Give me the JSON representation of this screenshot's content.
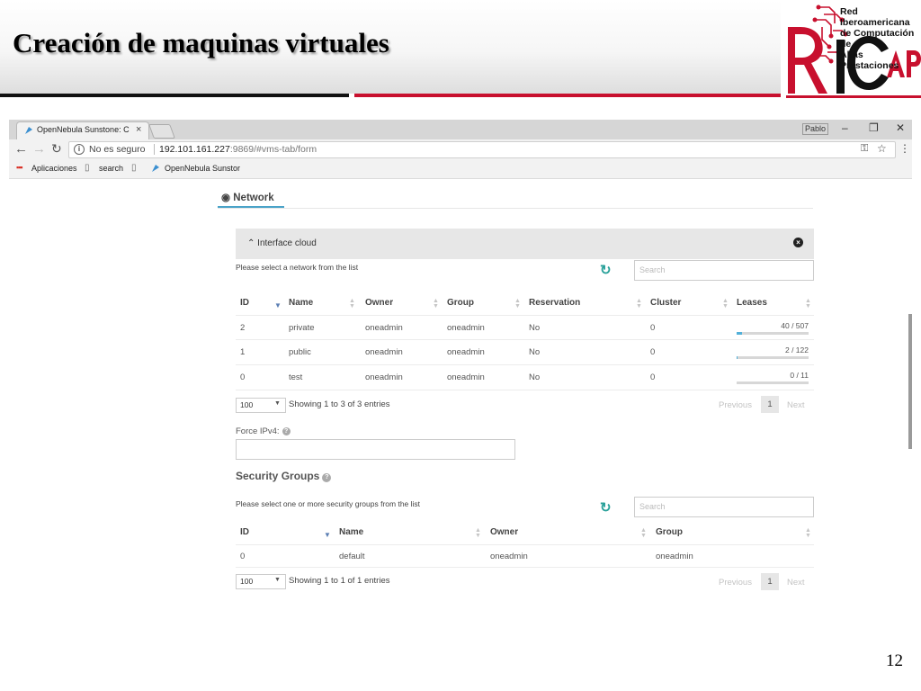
{
  "slide": {
    "title": "Creación de maquinas virtuales",
    "page_number": "12",
    "logo": {
      "text_lines": [
        "Red Iberoamericana",
        "de Computación de",
        "Altas Prestaciones"
      ],
      "mark": "RICAP"
    },
    "colors": {
      "red": "#c8102e",
      "black": "#111111"
    }
  },
  "browser": {
    "tab_title": "OpenNebula Sunstone: C",
    "window_user": "Pablo",
    "security_label": "No es seguro",
    "url_host": "192.101.161.227",
    "url_path": ":9869/#vms-tab/form",
    "bookmarks": [
      "Aplicaciones",
      "search",
      "OpenNebula Sunstor"
    ]
  },
  "page": {
    "network_tab": "Network",
    "interface": {
      "title": "Interface cloud",
      "hint": "Please select a network from the list",
      "search_placeholder": "Search",
      "columns": [
        "ID",
        "Name",
        "Owner",
        "Group",
        "Reservation",
        "Cluster",
        "Leases"
      ],
      "rows": [
        {
          "id": "2",
          "name": "private",
          "owner": "oneadmin",
          "group": "oneadmin",
          "reservation": "No",
          "cluster": "0",
          "leases": "40 / 507",
          "lease_fraction": 0.079
        },
        {
          "id": "1",
          "name": "public",
          "owner": "oneadmin",
          "group": "oneadmin",
          "reservation": "No",
          "cluster": "0",
          "leases": "2 / 122",
          "lease_fraction": 0.016
        },
        {
          "id": "0",
          "name": "test",
          "owner": "oneadmin",
          "group": "oneadmin",
          "reservation": "No",
          "cluster": "0",
          "leases": "0 / 11",
          "lease_fraction": 0
        }
      ],
      "page_length": "100",
      "showing": "Showing 1 to 3 of 3 entries",
      "prev": "Previous",
      "current_page": "1",
      "next": "Next"
    },
    "force_ipv4_label": "Force IPv4:",
    "security_groups": {
      "title": "Security Groups",
      "hint": "Please select one or more security groups from the list",
      "search_placeholder": "Search",
      "columns": [
        "ID",
        "Name",
        "Owner",
        "Group"
      ],
      "rows": [
        {
          "id": "0",
          "name": "default",
          "owner": "oneadmin",
          "group": "oneadmin"
        }
      ],
      "page_length": "100",
      "showing": "Showing 1 to 1 of 1 entries",
      "prev": "Previous",
      "current_page": "1",
      "next": "Next"
    }
  }
}
